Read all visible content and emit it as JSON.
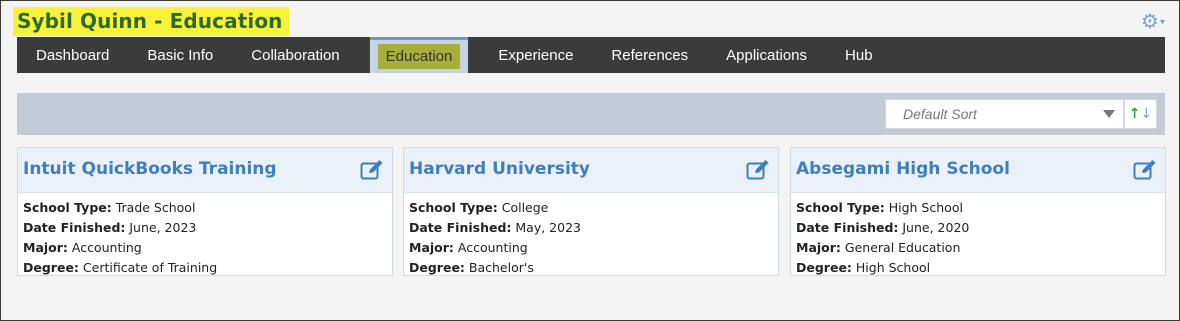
{
  "page": {
    "title": "Sybil Quinn - Education"
  },
  "header": {
    "settings_icon": "gear-icon"
  },
  "nav": {
    "items": [
      {
        "label": "Dashboard"
      },
      {
        "label": "Basic Info"
      },
      {
        "label": "Collaboration"
      },
      {
        "label": "Education",
        "active": true
      },
      {
        "label": "Experience"
      },
      {
        "label": "References"
      },
      {
        "label": "Applications"
      },
      {
        "label": "Hub"
      }
    ]
  },
  "sort": {
    "selected": "Default Sort",
    "toggle_icon": "sort-up-down-arrows-icon"
  },
  "labels": {
    "school_type": "School Type:",
    "date_finished": "Date Finished:",
    "major": "Major:",
    "degree": "Degree:"
  },
  "cards": [
    {
      "title": "Intuit QuickBooks Training",
      "school_type": "Trade School",
      "date_finished": "June, 2023",
      "major": "Accounting",
      "degree": "Certificate of Training"
    },
    {
      "title": "Harvard University",
      "school_type": "College",
      "date_finished": "May, 2023",
      "major": "Accounting",
      "degree": "Bachelor's"
    },
    {
      "title": "Absegami High School",
      "school_type": "High School",
      "date_finished": "June, 2020",
      "major": "General Education",
      "degree": "High School"
    }
  ],
  "colors": {
    "title_highlight": "#f7f23a",
    "title_text": "#2d6a2a",
    "nav_bg": "#3b3b3b",
    "active_tab_bg": "#c6d3e3",
    "active_tab_highlight": "#a8ae3a",
    "card_title": "#3d7fbf"
  }
}
